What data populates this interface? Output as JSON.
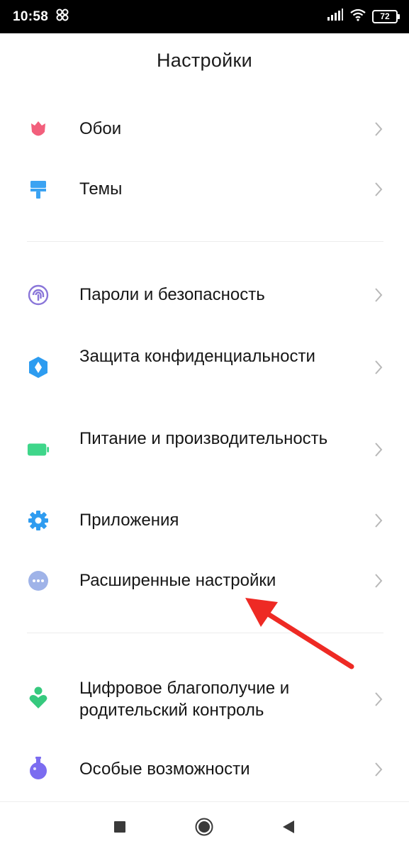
{
  "status_bar": {
    "time": "10:58",
    "battery_level": "72",
    "icons": [
      "pinwheel-icon",
      "signal-icon",
      "wifi-icon",
      "battery-icon"
    ]
  },
  "header": {
    "title": "Настройки"
  },
  "settings": {
    "items": [
      {
        "label": "Обои",
        "icon": "tulip-icon",
        "color": "#f25f7c"
      },
      {
        "label": "Темы",
        "icon": "paint-roller-icon",
        "color": "#3ba3f2"
      },
      {
        "label": "Пароли и безопасность",
        "icon": "fingerprint-icon",
        "color": "#8a76d9"
      },
      {
        "label": "Защита конфиденциальности",
        "icon": "privacy-cube-icon",
        "color": "#2d9cf0"
      },
      {
        "label": "Питание и производительность",
        "icon": "battery-icon",
        "color": "#3fd68a"
      },
      {
        "label": "Приложения",
        "icon": "gear-icon",
        "color": "#2f9cf0"
      },
      {
        "label": "Расширенные настройки",
        "icon": "more-dots-icon",
        "color": "#9fb3e8"
      },
      {
        "label": "Цифровое благополучие и родительский контроль",
        "icon": "wellbeing-person-icon",
        "color": "#36c97e"
      },
      {
        "label": "Особые возможности",
        "icon": "flask-icon",
        "color": "#7b6cf0"
      }
    ]
  },
  "navigation_bar": {
    "buttons": [
      "recents-square-icon",
      "home-circle-icon",
      "back-triangle-icon"
    ]
  },
  "annotation": {
    "arrow_color": "#ee2a24"
  }
}
